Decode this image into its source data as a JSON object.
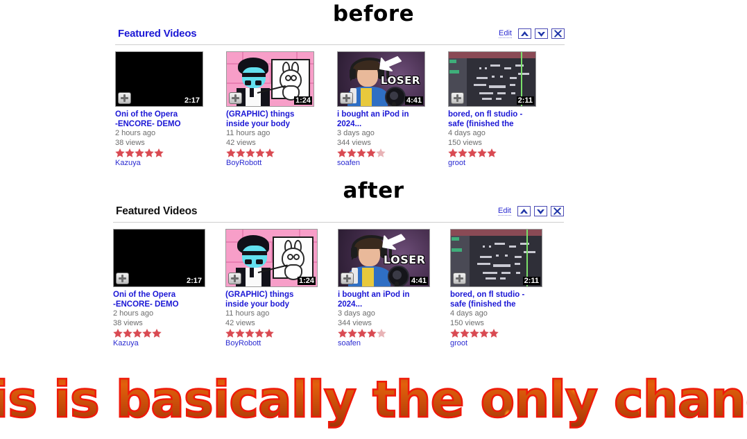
{
  "annotations": {
    "before_label": "before",
    "after_label": "after",
    "caption": "this is basically the only change"
  },
  "module": {
    "title": "Featured Videos",
    "edit_label": "Edit",
    "controls": {
      "move_up": "move-up",
      "move_down": "move-down",
      "close": "close"
    },
    "title_color_before": "#1b17d5",
    "title_color_after": "#111111"
  },
  "videos": [
    {
      "title_line1": "Oni of the Opera",
      "title_line2": "-ENCORE- DEMO",
      "age": "2 hours ago",
      "views": "38 views",
      "rating": 5,
      "user": "Kazuya",
      "duration": "2:17",
      "thumb": "black"
    },
    {
      "title_line1": "(GRAPHIC) things",
      "title_line2": "inside your body",
      "age": "11 hours ago",
      "views": "42 views",
      "rating": 5,
      "user": "BoyRobott",
      "duration": "1:24",
      "thumb": "pink-cartoon"
    },
    {
      "title_line1": "i bought an iPod in",
      "title_line2": "2024...",
      "age": "3 days ago",
      "views": "344 views",
      "rating": 4.5,
      "user": "soafen",
      "duration": "4:41",
      "thumb": "loser",
      "overlay_text": "LOSER"
    },
    {
      "title_line1": "bored, on fl studio -",
      "title_line2": "safe (finished the",
      "age": "4 days ago",
      "views": "150 views",
      "rating": 5,
      "user": "groot",
      "duration": "2:11",
      "thumb": "fl-studio"
    }
  ],
  "colors": {
    "link_blue": "#1b17d5",
    "meta_gray": "#6d6d6d",
    "star_full": "#d94a52",
    "star_empty": "#e8b3b6",
    "flame_red": "#ee1508"
  }
}
